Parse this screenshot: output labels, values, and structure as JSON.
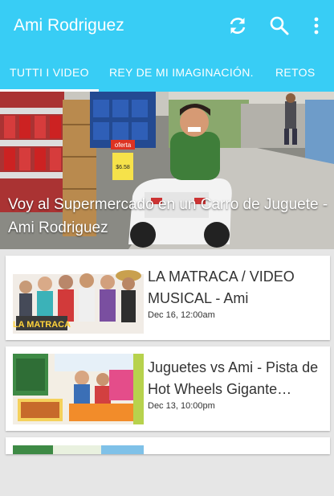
{
  "app": {
    "title": "Ami Rodriguez",
    "accent_color": "#38cdf5",
    "actions": [
      "refresh-icon",
      "search-icon",
      "more-vert-icon"
    ]
  },
  "tabs": [
    {
      "label": "TUTTI I VIDEO",
      "selected": true
    },
    {
      "label": "REY DE MI IMAGINACIÓN.",
      "selected": false
    },
    {
      "label": "RETOS",
      "selected": false
    }
  ],
  "featured": {
    "title": "Voy al Supermercado en un Carro de Juguete - Ami Rodriguez",
    "sign_text": "oferta",
    "price_text": "$6.58"
  },
  "videos": [
    {
      "title": "LA MATRACA / VIDEO MUSICAL - Ami",
      "date": "Dec 16, 12:00am",
      "thumb_caption": "LA MATRACA"
    },
    {
      "title": "Juguetes vs Ami - Pista de Hot Wheels Gigante…",
      "date": "Dec 13, 10:00pm"
    },
    {
      "title": "",
      "date": ""
    }
  ]
}
